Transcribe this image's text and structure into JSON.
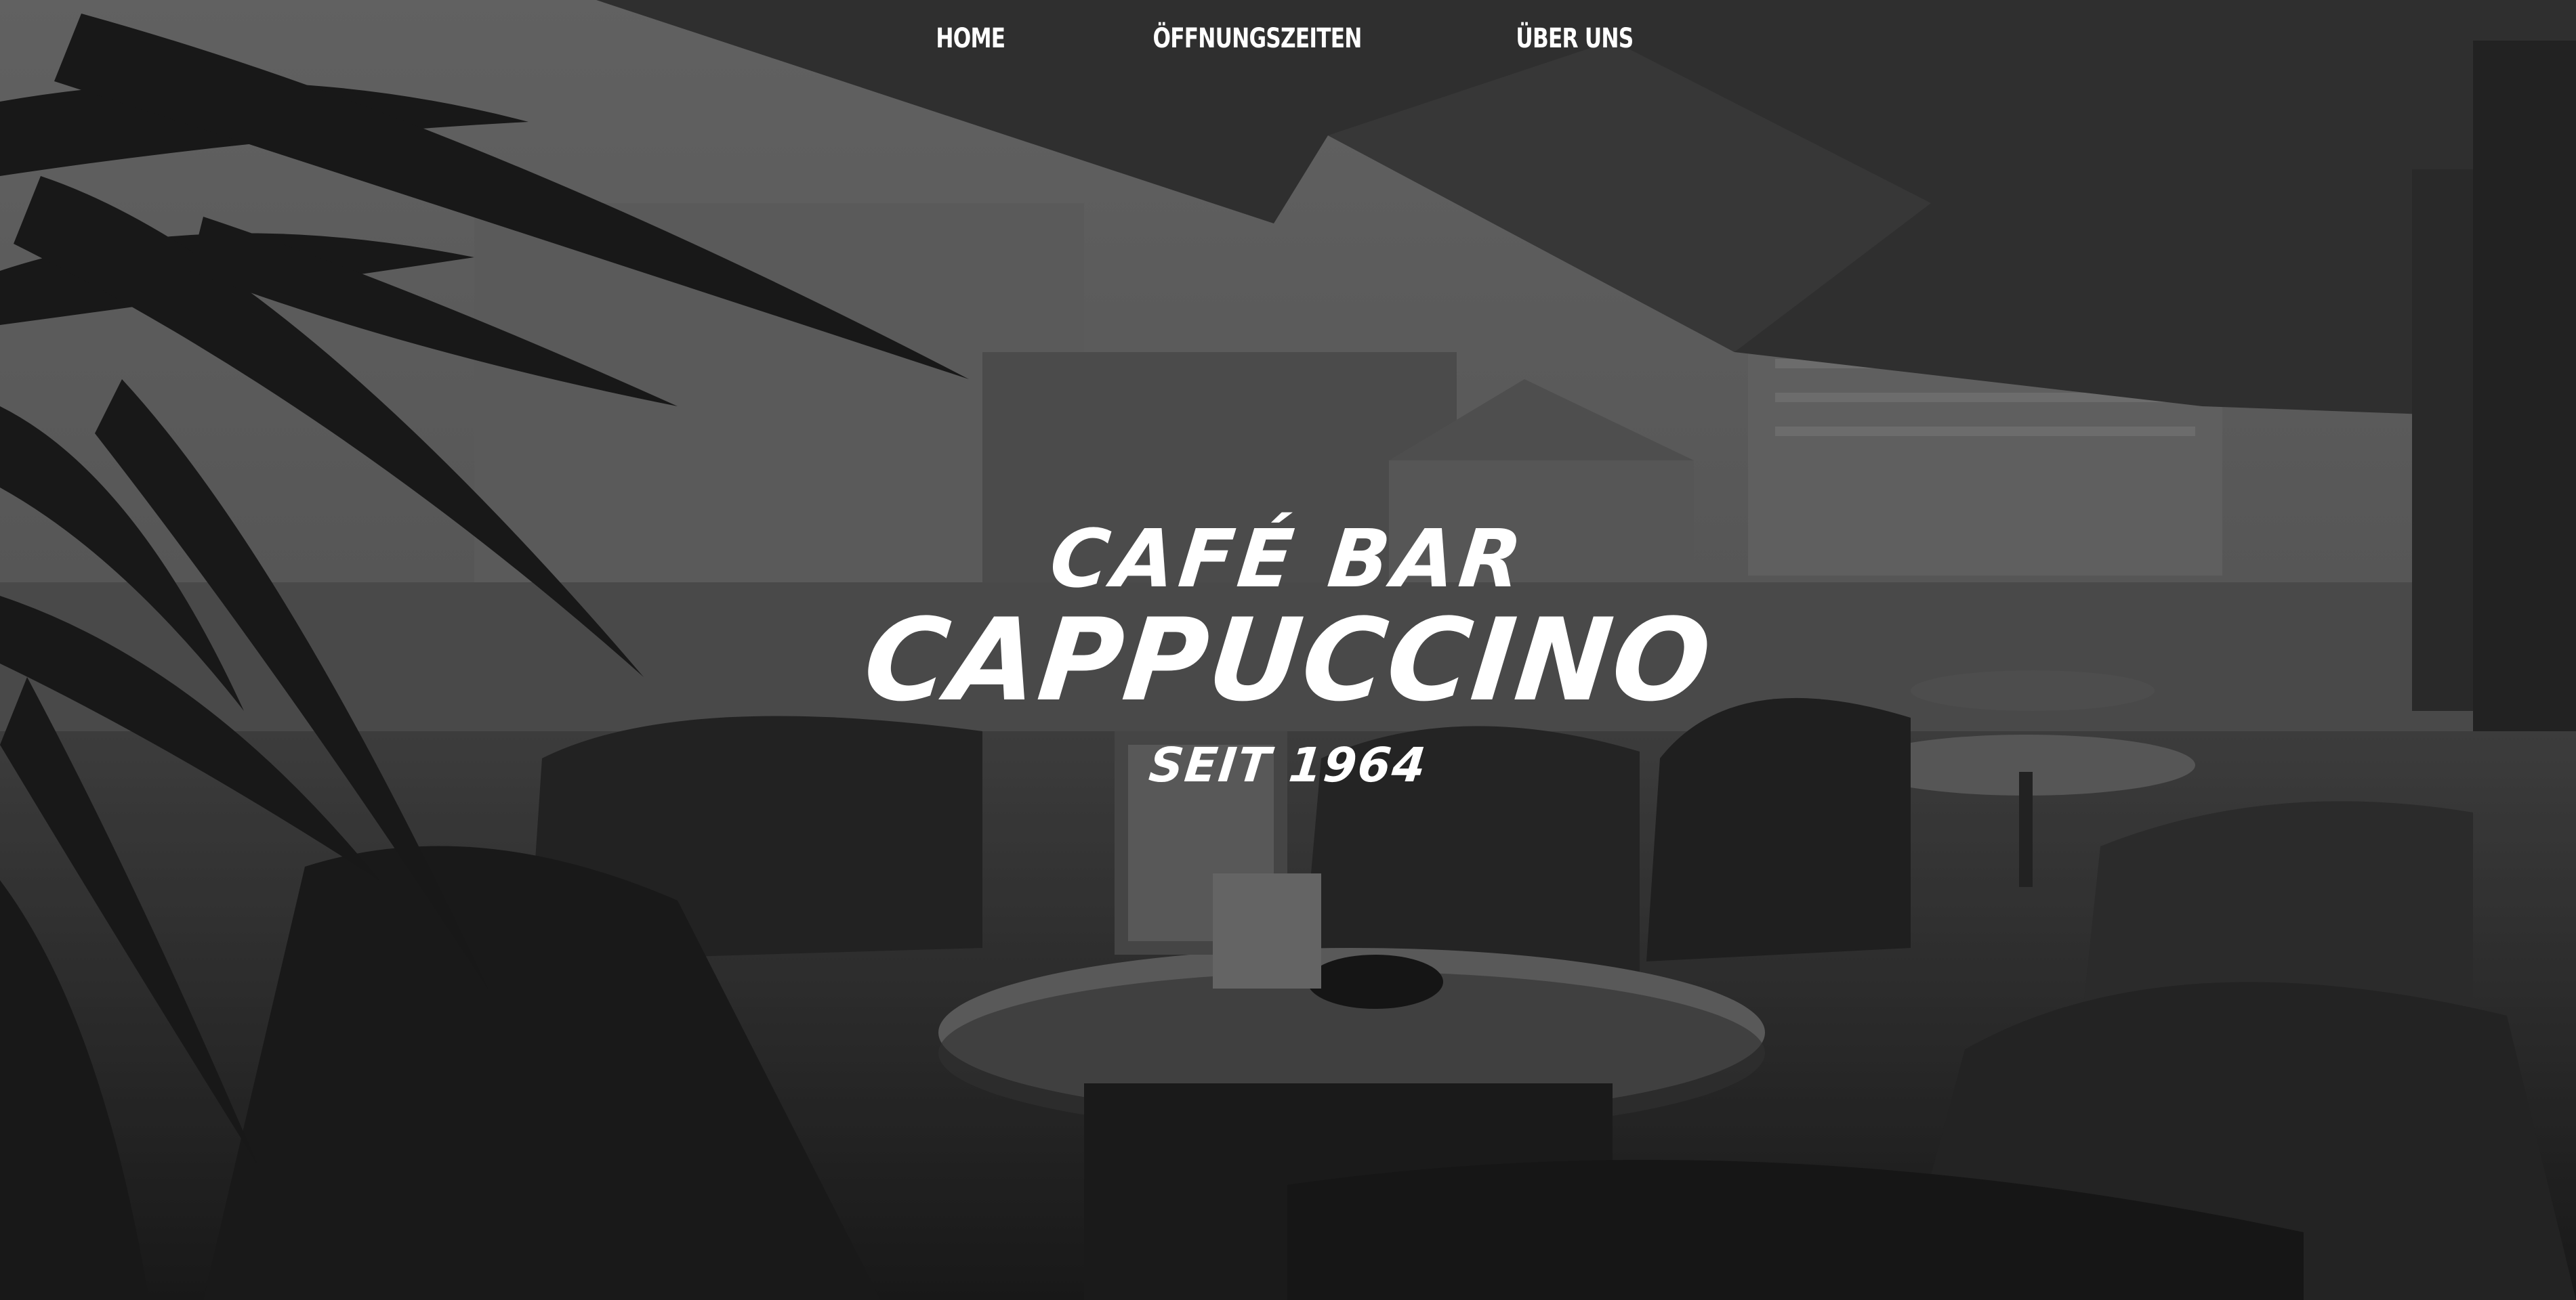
{
  "nav": {
    "items": [
      {
        "label": "HOME"
      },
      {
        "label": "ÖFFNUNGSZEITEN"
      },
      {
        "label": "ÜBER UNS"
      }
    ]
  },
  "hero": {
    "line1": "CAFÉ BAR",
    "line2": "CAPPUCCINO",
    "line3": "SEIT 1964"
  },
  "colors": {
    "text": "#ffffff",
    "background": "#3a3a3a"
  },
  "background_image": "grayscale-photo-cafe-terrace-tables-chairs-plant-awning"
}
